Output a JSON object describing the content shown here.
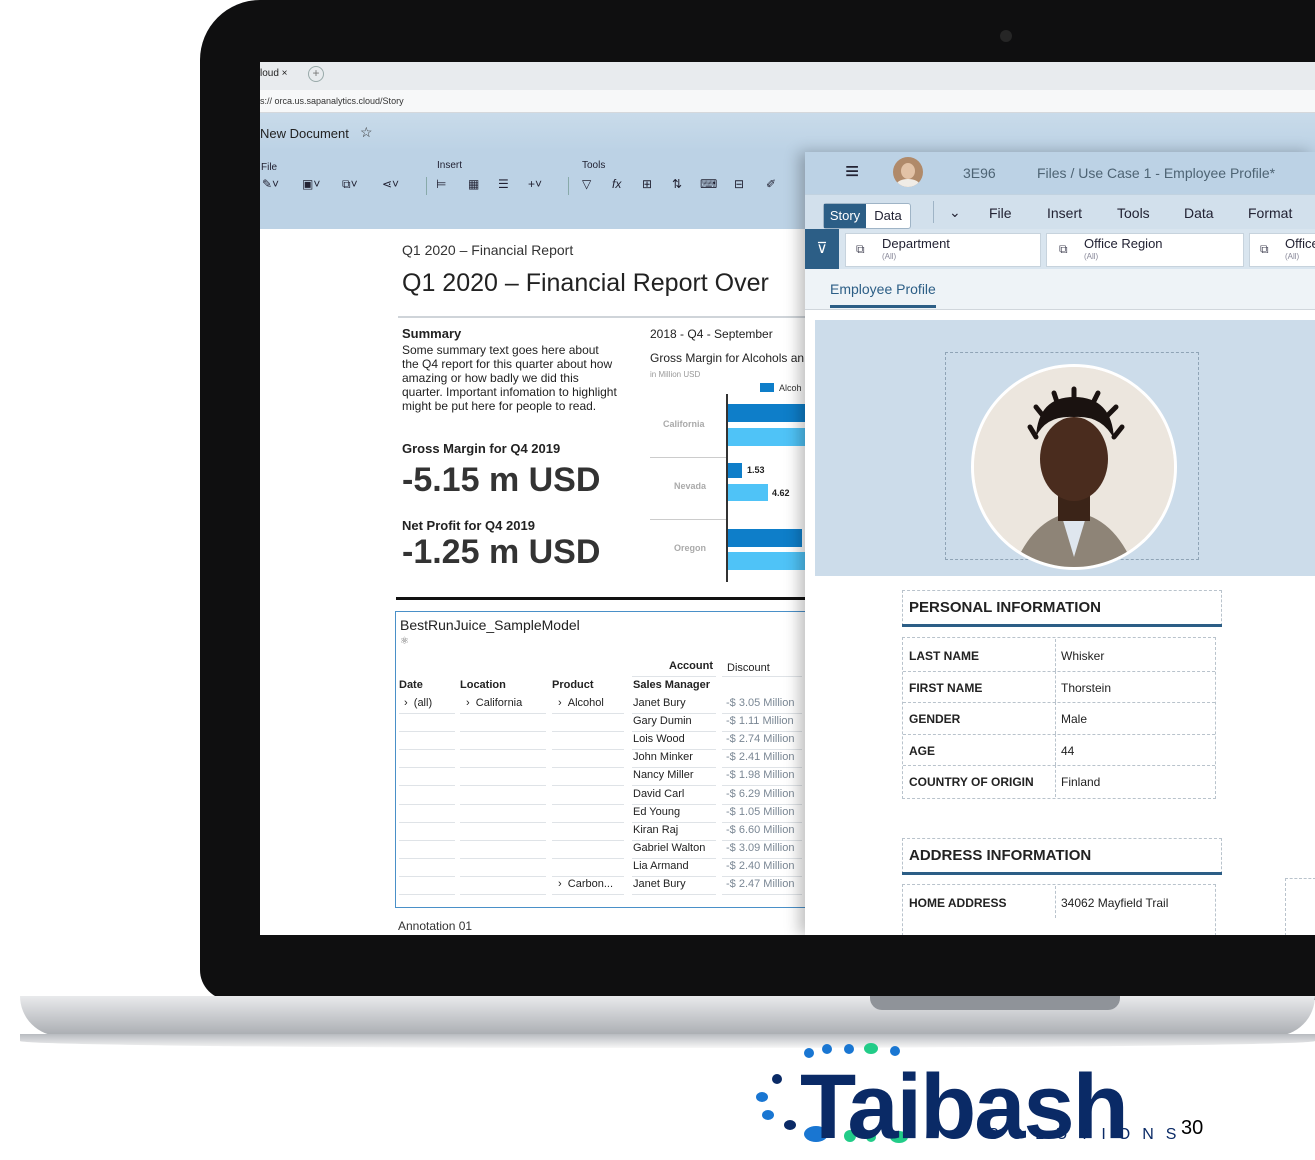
{
  "browser": {
    "tab_label": "loud ×",
    "new_tab": "+",
    "address": "s:// orca.us.sapanalytics.cloud/Story"
  },
  "doc": {
    "title": "New Document",
    "star": "☆"
  },
  "ribbon": {
    "file_label": "File",
    "insert_label": "Insert",
    "tools_label": "Tools"
  },
  "report": {
    "subtitle": "Q1 2020 – Financial Report",
    "title": "Q1 2020 – Financial Report Over",
    "summary_heading": "Summary",
    "summary_text": "Some summary text goes here about the Q4 report for this quarter about how amazing or how badly we did this quarter. Important infomation to highlight might be put here for people to read.",
    "gm_label": "Gross Margin for Q4 2019",
    "gm_value": "-5.15 m USD",
    "np_label": "Net Profit for Q4 2019",
    "np_value": "-1.25 m USD",
    "annotation": "Annotation 01"
  },
  "chart_data": {
    "type": "bar",
    "title": "Gross Margin for Alcohols an",
    "subtitle": "in Million USD",
    "period": "2018 - Q4 - September",
    "legend": "Alcoh",
    "categories": [
      "California",
      "Nevada",
      "Oregon"
    ],
    "series": [
      {
        "name": "",
        "values": [
          null,
          1.53,
          null
        ],
        "color": "#0e7ec9"
      },
      {
        "name": "",
        "values": [
          null,
          4.62,
          null
        ],
        "color": "#4fc3f7"
      }
    ],
    "data_labels": [
      "1.53",
      "4.62"
    ]
  },
  "table": {
    "model": "BestRunJuice_SampleModel",
    "header_account": "Account",
    "header_discount": "Discount",
    "col_date": "Date",
    "col_location": "Location",
    "col_product": "Product",
    "col_manager": "Sales Manager",
    "first_date": "(all)",
    "first_location": "California",
    "first_product": "Alcohol",
    "last_product": "Carbon...",
    "rows": [
      {
        "manager": "Janet Bury",
        "discount": "-$ 3.05 Million"
      },
      {
        "manager": "Gary Dumin",
        "discount": "-$ 1.11 Million"
      },
      {
        "manager": "Lois Wood",
        "discount": "-$ 2.74 Million"
      },
      {
        "manager": "John Minker",
        "discount": "-$ 2.41 Million"
      },
      {
        "manager": "Nancy Miller",
        "discount": "-$ 1.98 Million"
      },
      {
        "manager": "David Carl",
        "discount": "-$ 6.29 Million"
      },
      {
        "manager": "Ed Young",
        "discount": "-$ 1.05 Million"
      },
      {
        "manager": "Kiran Raj",
        "discount": "-$ 6.60 Million"
      },
      {
        "manager": "Gabriel Walton",
        "discount": "-$ 3.09 Million"
      },
      {
        "manager": "Lia Armand",
        "discount": "-$ 2.40 Million"
      },
      {
        "manager": "Janet Bury",
        "discount": "-$ 2.47 Million"
      }
    ]
  },
  "overlay": {
    "hamburger": "≡",
    "code": "3E96",
    "breadcrumb": "Files  /  Use Case 1 - Employee Profile*",
    "story": "Story",
    "data_seg": "Data",
    "menu": [
      "File",
      "Insert",
      "Tools",
      "Data",
      "Format"
    ],
    "filters": [
      {
        "title": "Department",
        "sub": "(All)"
      },
      {
        "title": "Office Region",
        "sub": "(All)"
      },
      {
        "title": "Office",
        "sub": "(All)"
      }
    ],
    "tab": "Employee Profile",
    "personal_heading": "PERSONAL INFORMATION",
    "personal": [
      {
        "k": "LAST NAME",
        "v": "Whisker"
      },
      {
        "k": "FIRST NAME",
        "v": "Thorstein"
      },
      {
        "k": "GENDER",
        "v": "Male"
      },
      {
        "k": "AGE",
        "v": "44"
      },
      {
        "k": "COUNTRY OF ORIGIN",
        "v": "Finland"
      }
    ],
    "address_heading": "ADDRESS INFORMATION",
    "address": [
      {
        "k": "HOME ADDRESS",
        "v": "34062 Mayfield Trail"
      }
    ]
  },
  "logo": {
    "word": "Taibash",
    "sub": "SOLUTIONS",
    "page_number": "30",
    "colors": {
      "navy": "#0a2a66",
      "blue": "#1976d2",
      "green": "#22cc88"
    }
  }
}
